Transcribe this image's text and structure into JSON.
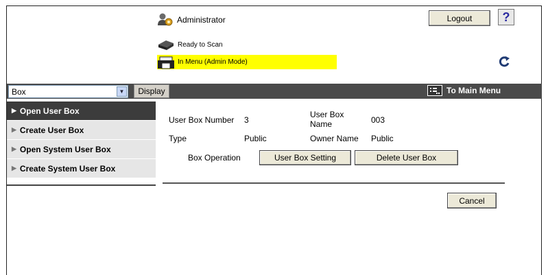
{
  "header": {
    "user_label": "Administrator",
    "logout_label": "Logout",
    "help_label": "?"
  },
  "status": {
    "scanner": "Ready to Scan",
    "printer": "In Menu (Admin Mode)"
  },
  "toolbar": {
    "select_value": "Box",
    "display_label": "Display",
    "main_menu_label": "To Main Menu"
  },
  "sidebar": {
    "items": [
      {
        "label": "Open User Box"
      },
      {
        "label": "Create User Box"
      },
      {
        "label": "Open System User Box"
      },
      {
        "label": "Create System User Box"
      }
    ]
  },
  "box_info": {
    "number_label": "User Box Number",
    "number_value": "3",
    "name_label_line1": "User Box",
    "name_label_line2": "Name",
    "name_value": "003",
    "type_label": "Type",
    "type_value": "Public",
    "owner_label": "Owner Name",
    "owner_value": "Public",
    "operation_label": "Box Operation",
    "setting_button": "User Box Setting",
    "delete_button": "Delete User Box"
  },
  "footer": {
    "cancel_label": "Cancel"
  },
  "colors": {
    "toolbar_bg": "#4a4a4a",
    "active_item_bg": "#3c3c3c",
    "status_highlight": "#ffff00",
    "button_face": "#ece9d8"
  }
}
